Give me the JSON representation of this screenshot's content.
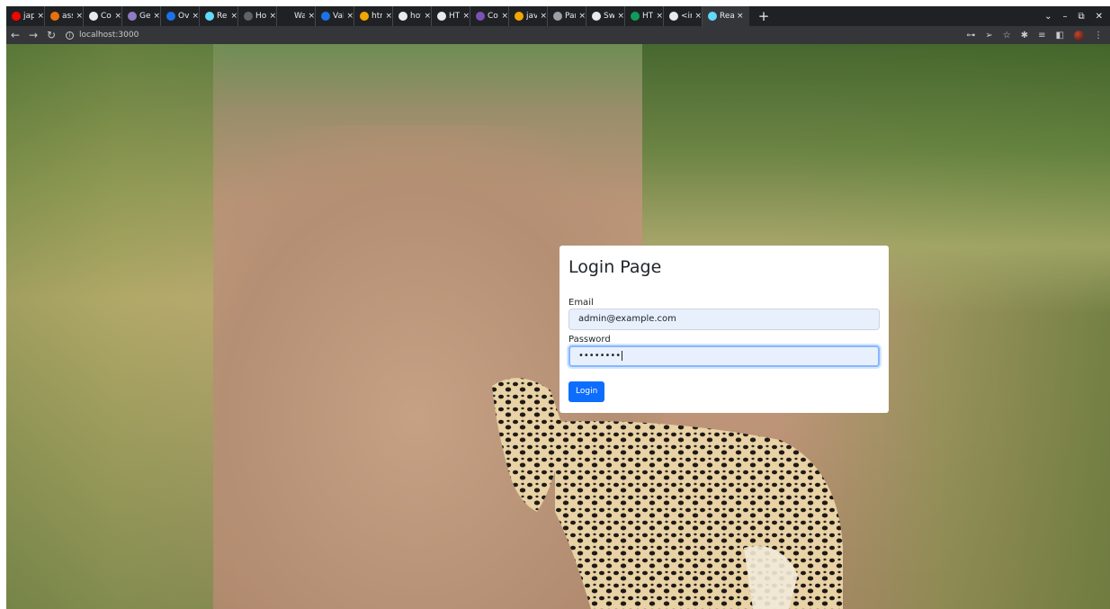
{
  "browser": {
    "tabs": [
      {
        "title": "japa",
        "color": "#ff0000"
      },
      {
        "title": "assi",
        "color": "#e8710a"
      },
      {
        "title": "Cop",
        "color": "#e8eaed"
      },
      {
        "title": "Get",
        "color": "#8e7cc3"
      },
      {
        "title": "Ove",
        "color": "#1a73e8"
      },
      {
        "title": "Rea",
        "color": "#61dafb"
      },
      {
        "title": "Hor",
        "color": "#5f6368"
      },
      {
        "title": "Wa",
        "color": "#202124"
      },
      {
        "title": "Vali",
        "color": "#1a73e8"
      },
      {
        "title": "htm",
        "color": "#f2a600"
      },
      {
        "title": "how",
        "color": "#e8eaed"
      },
      {
        "title": "HTI",
        "color": "#e8eaed"
      },
      {
        "title": "Colo",
        "color": "#7952b3"
      },
      {
        "title": "java",
        "color": "#f2a600"
      },
      {
        "title": "Part",
        "color": "#9aa0a6"
      },
      {
        "title": "Swe",
        "color": "#e8eaed"
      },
      {
        "title": "HTM",
        "color": "#0f9d58"
      },
      {
        "title": "<inp",
        "color": "#e8eaed"
      },
      {
        "title": "Rea",
        "color": "#61dafb",
        "active": true
      }
    ],
    "close_glyph": "×",
    "new_tab_glyph": "+",
    "url": "localhost:3000"
  },
  "login": {
    "title": "Login Page",
    "email_label": "Email",
    "email_value": "admin@example.com",
    "password_label": "Password",
    "password_value": "••••••••",
    "button_label": "Login"
  },
  "colors": {
    "primary": "#0d6efd",
    "focus_ring": "#86b7fe",
    "autofill_bg": "#e8f0fe"
  }
}
